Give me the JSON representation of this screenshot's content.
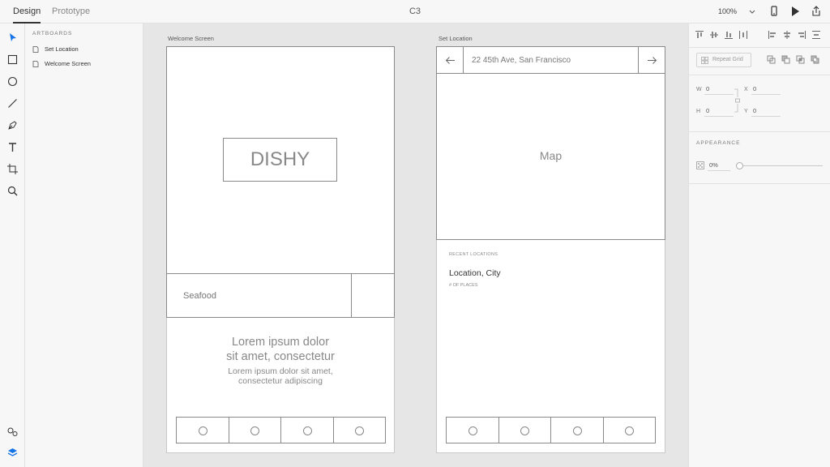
{
  "topbar": {
    "tab_design": "Design",
    "tab_prototype": "Prototype",
    "doc_title": "C3",
    "zoom": "100%"
  },
  "layers": {
    "heading": "ARTBOARDS",
    "items": [
      "Set Location",
      "Welcome Screen"
    ]
  },
  "artboards": {
    "welcome": {
      "label": "Welcome Screen",
      "logo": "DISHY",
      "search_text": "Seafood",
      "headline_1": "Lorem ipsum dolor",
      "headline_2": "sit amet, consectetur",
      "body_1": "Lorem ipsum dolor sit amet,",
      "body_2": "consectetur adipiscing"
    },
    "location": {
      "label": "Set Location",
      "address": "22 45th Ave, San Francisco",
      "map": "Map",
      "recent_heading": "RECENT LOCATIONS",
      "location_name": "Location, City",
      "places": "# OF PLACES"
    }
  },
  "props": {
    "repeat_grid": "Repeat Grid",
    "w_label": "W",
    "w_value": "0",
    "x_label": "X",
    "x_value": "0",
    "h_label": "H",
    "h_value": "0",
    "y_label": "Y",
    "y_value": "0",
    "appearance": "APPEARANCE",
    "opacity": "0%"
  },
  "colors": {
    "accent": "#1473e6"
  }
}
